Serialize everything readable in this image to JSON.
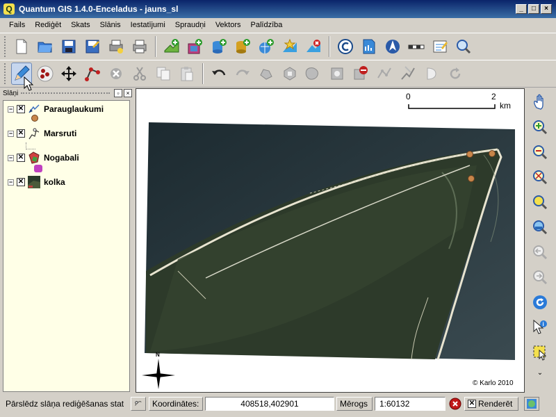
{
  "window": {
    "title": "Quantum GIS 1.4.0-Enceladus - jauns_sl",
    "app_icon": "Q"
  },
  "menu": [
    "Fails",
    "Rediģēt",
    "Skats",
    "Slānis",
    "Iestatījumi",
    "Spraudņi",
    "Vektors",
    "Palīdzība"
  ],
  "layers_panel": {
    "title": "Slāņi",
    "layers": [
      {
        "name": "Parauglaukumi",
        "checked": true,
        "icon": "point-layer-icon"
      },
      {
        "name": "Marsruti",
        "checked": true,
        "icon": "line-layer-icon"
      },
      {
        "name": "Nogabali",
        "checked": true,
        "icon": "polygon-layer-icon"
      },
      {
        "name": "kolka",
        "checked": true,
        "icon": "raster-layer-icon"
      }
    ]
  },
  "map": {
    "scalebar": {
      "start": "0",
      "end": "2",
      "unit": "km"
    },
    "copyright": "© Karlo 2010",
    "north_label": "N"
  },
  "statusbar": {
    "message": "Pārslēdz slāņa rediģēšanas stat",
    "coord_label": "Koordinātes:",
    "coord_value": "408518,402901",
    "scale_label": "Mērogs",
    "scale_value": "1:60132",
    "render_label": "Renderēt",
    "render_checked": true
  },
  "colors": {
    "title_bar": "#0a246a",
    "legend_bg": "#ffffe7",
    "point_marker": "#c8864a"
  }
}
